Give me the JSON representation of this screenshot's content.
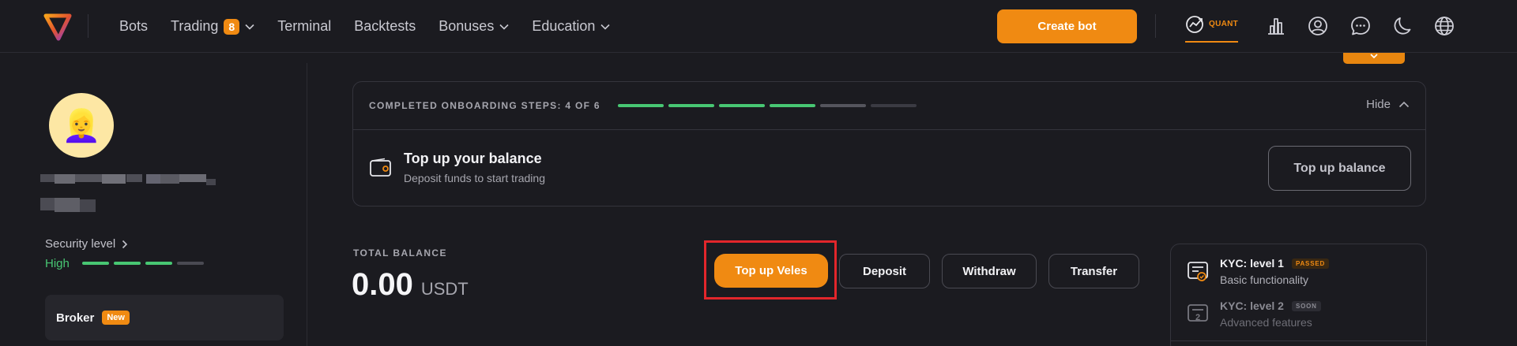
{
  "nav": {
    "items": [
      {
        "label": "Bots"
      },
      {
        "label": "Trading",
        "badge": "8"
      },
      {
        "label": "Terminal"
      },
      {
        "label": "Backtests"
      },
      {
        "label": "Bonuses"
      },
      {
        "label": "Education"
      }
    ],
    "create_bot": "Create bot",
    "quant_label": "QUANT",
    "icons": [
      "quant-chart-icon",
      "bar-chart-icon",
      "user-circle-icon",
      "chat-icon",
      "moon-icon",
      "globe-icon"
    ]
  },
  "sidebar": {
    "security_label": "Security level",
    "security_value": "High",
    "security_level": 3,
    "security_max": 4,
    "broker_label": "Broker",
    "broker_badge": "New"
  },
  "onboarding": {
    "title": "COMPLETED ONBOARDING STEPS: 4 OF 6",
    "completed": 4,
    "total": 6,
    "hide_label": "Hide",
    "task_title": "Top up your balance",
    "task_subtitle": "Deposit funds to start trading",
    "task_button": "Top up balance"
  },
  "balance": {
    "label": "TOTAL BALANCE",
    "value": "0.00",
    "currency": "USDT"
  },
  "actions": {
    "top_up_veles": "Top up Veles",
    "deposit": "Deposit",
    "withdraw": "Withdraw",
    "transfer": "Transfer"
  },
  "kyc": [
    {
      "title": "KYC: level 1",
      "badge": "PASSED",
      "subtitle": "Basic functionality"
    },
    {
      "title": "KYC: level 2",
      "badge": "SOON",
      "subtitle": "Advanced features"
    }
  ],
  "colors": {
    "accent": "#f08a12",
    "success": "#48c773",
    "highlight": "#e3262b",
    "background": "#1b1b20"
  }
}
